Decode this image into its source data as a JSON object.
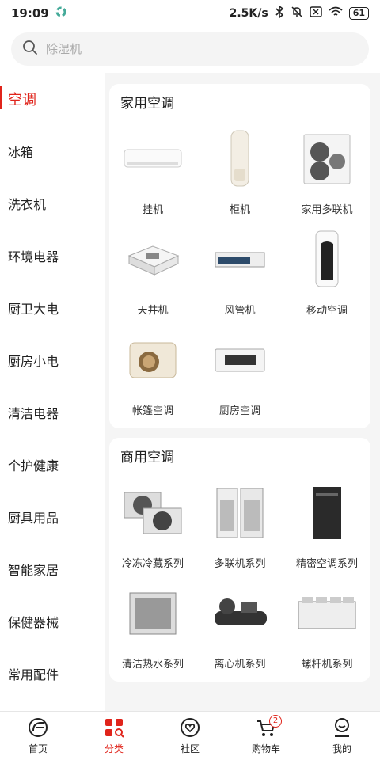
{
  "status": {
    "time": "19:09",
    "speed": "2.5K/s",
    "battery": "61"
  },
  "search": {
    "placeholder": "除湿机"
  },
  "sidebar": {
    "items": [
      {
        "label": "空调"
      },
      {
        "label": "冰箱"
      },
      {
        "label": "洗衣机"
      },
      {
        "label": "环境电器"
      },
      {
        "label": "厨卫大电"
      },
      {
        "label": "厨房小电"
      },
      {
        "label": "清洁电器"
      },
      {
        "label": "个护健康"
      },
      {
        "label": "厨具用品"
      },
      {
        "label": "智能家居"
      },
      {
        "label": "保健器械"
      },
      {
        "label": "常用配件"
      }
    ]
  },
  "sections": [
    {
      "title": "家用空调",
      "items": [
        {
          "label": "挂机",
          "icon": "wall-ac-icon"
        },
        {
          "label": "柜机",
          "icon": "floor-ac-icon"
        },
        {
          "label": "家用多联机",
          "icon": "multi-split-icon"
        },
        {
          "label": "天井机",
          "icon": "cassette-ac-icon"
        },
        {
          "label": "风管机",
          "icon": "duct-ac-icon"
        },
        {
          "label": "移动空调",
          "icon": "portable-ac-icon"
        },
        {
          "label": "帐篷空调",
          "icon": "tent-ac-icon"
        },
        {
          "label": "厨房空调",
          "icon": "kitchen-ac-icon"
        }
      ]
    },
    {
      "title": "商用空调",
      "items": [
        {
          "label": "冷冻冷藏系列",
          "icon": "refrigeration-unit-icon"
        },
        {
          "label": "多联机系列",
          "icon": "vrf-unit-icon"
        },
        {
          "label": "精密空调系列",
          "icon": "precision-ac-icon"
        },
        {
          "label": "清洁热水系列",
          "icon": "heat-pump-icon"
        },
        {
          "label": "离心机系列",
          "icon": "centrifugal-chiller-icon"
        },
        {
          "label": "螺杆机系列",
          "icon": "screw-chiller-icon"
        }
      ]
    }
  ],
  "tabbar": {
    "items": [
      {
        "label": "首页"
      },
      {
        "label": "分类"
      },
      {
        "label": "社区"
      },
      {
        "label": "购物车"
      },
      {
        "label": "我的"
      }
    ],
    "cart_count": "2"
  },
  "colors": {
    "accent": "#e0241b",
    "background": "#f5f5f5"
  }
}
